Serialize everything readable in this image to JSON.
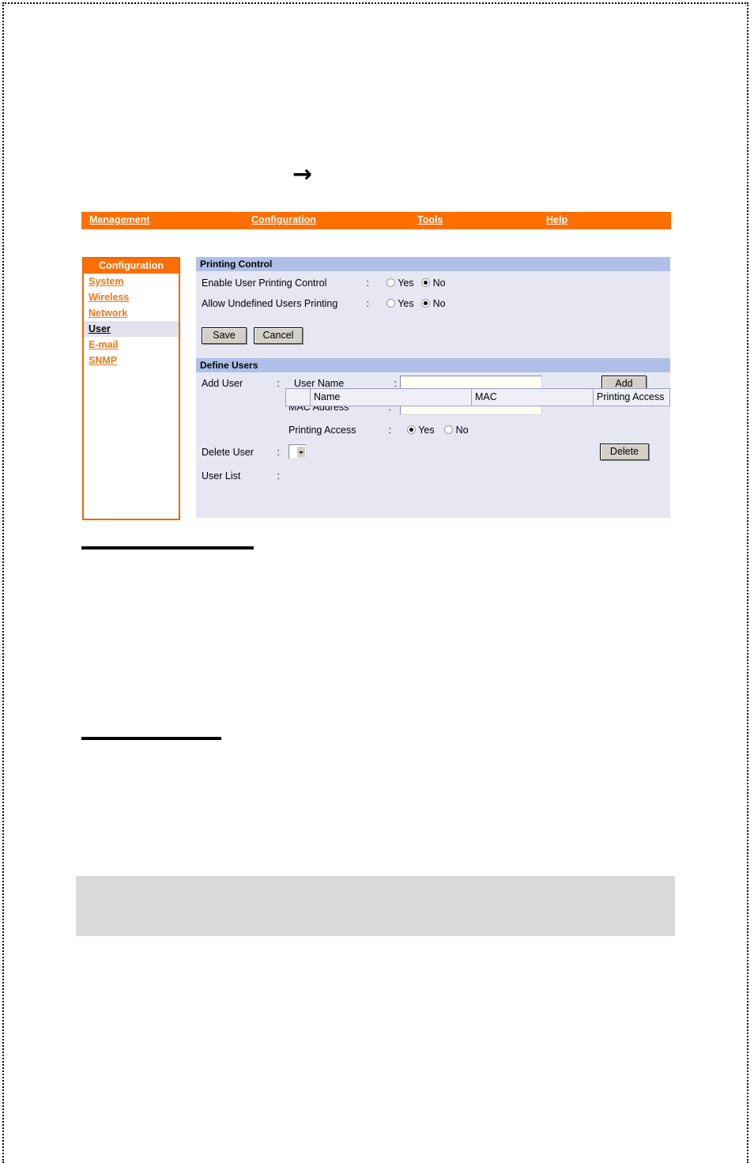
{
  "page": {
    "arrow_glyph": "→"
  },
  "topnav": {
    "items": [
      {
        "label": "Management"
      },
      {
        "label": "Configuration"
      },
      {
        "label": "Tools"
      },
      {
        "label": "Help"
      }
    ]
  },
  "sidebar": {
    "title": "Configuration",
    "items": [
      {
        "label": "System",
        "active": false
      },
      {
        "label": "Wireless",
        "active": false
      },
      {
        "label": "Network",
        "active": false
      },
      {
        "label": "User",
        "active": true
      },
      {
        "label": "E-mail",
        "active": false
      },
      {
        "label": "SNMP",
        "active": false
      }
    ]
  },
  "printing_control": {
    "header": "Printing Control",
    "rows": [
      {
        "label": "Enable User Printing Control",
        "colon": ":",
        "yes_label": "Yes",
        "no_label": "No",
        "value": "No"
      },
      {
        "label": "Allow Undefined Users Printing",
        "colon": ":",
        "yes_label": "Yes",
        "no_label": "No",
        "value": "No"
      }
    ],
    "save_label": "Save",
    "cancel_label": "Cancel"
  },
  "define_users": {
    "header": "Define Users",
    "add_user_label": "Add User",
    "add_user_colon": ":",
    "user_name_label": "User Name",
    "user_name_colon": ":",
    "user_name_value": "",
    "user_name_placeholder": "",
    "mac_address_label": "MAC Address",
    "mac_address_colon": ":",
    "mac_address_value": "",
    "mac_address_placeholder": "",
    "printing_access_label": "Printing Access",
    "printing_access_colon": ":",
    "printing_access_yes": "Yes",
    "printing_access_no": "No",
    "printing_access_value": "Yes",
    "add_button_label": "Add",
    "delete_user_label": "Delete User",
    "delete_user_colon": ":",
    "delete_user_selected": "",
    "delete_button_label": "Delete",
    "user_list_label": "User List",
    "user_list_colon": ":",
    "user_list_columns": [
      "",
      "Name",
      "MAC",
      "Printing Access"
    ],
    "user_list_rows": []
  },
  "colors": {
    "nav_orange": "#FF6E00",
    "sidebar_border": "#EE6600",
    "link_orange": "#F07818",
    "section_header": "#AFC0E8",
    "panel_bg": "#E7E7F4",
    "gray_box": "#D9D9D9"
  }
}
